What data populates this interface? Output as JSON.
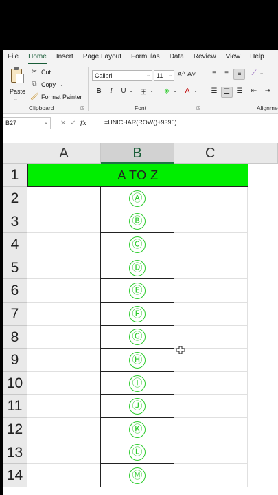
{
  "menu": {
    "tabs": [
      {
        "label": "File"
      },
      {
        "label": "Home",
        "active": true
      },
      {
        "label": "Insert"
      },
      {
        "label": "Page Layout"
      },
      {
        "label": "Formulas"
      },
      {
        "label": "Data"
      },
      {
        "label": "Review"
      },
      {
        "label": "View"
      },
      {
        "label": "Help"
      }
    ]
  },
  "ribbon": {
    "clipboard": {
      "paste_label": "Paste",
      "cut_label": "Cut",
      "copy_label": "Copy",
      "format_painter_label": "Format Painter",
      "group_label": "Clipboard"
    },
    "font": {
      "font_name": "Calibri",
      "font_size": "11",
      "grow_label": "A^",
      "shrink_label": "A˅",
      "bold_label": "B",
      "italic_label": "I",
      "underline_label": "U",
      "group_label": "Font"
    },
    "alignment": {
      "group_label": "Alignme"
    }
  },
  "formula_bar": {
    "name_box": "B27",
    "fx_label": "fx",
    "formula": "=UNICHAR(ROW()+9396)"
  },
  "sheet": {
    "columns": [
      "A",
      "B",
      "C"
    ],
    "selected_column": "B",
    "title": "A TO Z",
    "rows": [
      {
        "num": "1"
      },
      {
        "num": "2",
        "b": "Ⓐ"
      },
      {
        "num": "3",
        "b": "Ⓑ"
      },
      {
        "num": "4",
        "b": "Ⓒ"
      },
      {
        "num": "5",
        "b": "Ⓓ"
      },
      {
        "num": "6",
        "b": "Ⓔ"
      },
      {
        "num": "7",
        "b": "Ⓕ"
      },
      {
        "num": "8",
        "b": "Ⓖ"
      },
      {
        "num": "9",
        "b": "Ⓗ"
      },
      {
        "num": "10",
        "b": "Ⓘ"
      },
      {
        "num": "11",
        "b": "Ⓙ"
      },
      {
        "num": "12",
        "b": "Ⓚ"
      },
      {
        "num": "13",
        "b": "Ⓛ"
      },
      {
        "num": "14",
        "b": "Ⓜ"
      }
    ]
  },
  "colors": {
    "title_fill": "#00ee00",
    "circle_letter": "#2ecc2e",
    "excel_green": "#185c37"
  }
}
